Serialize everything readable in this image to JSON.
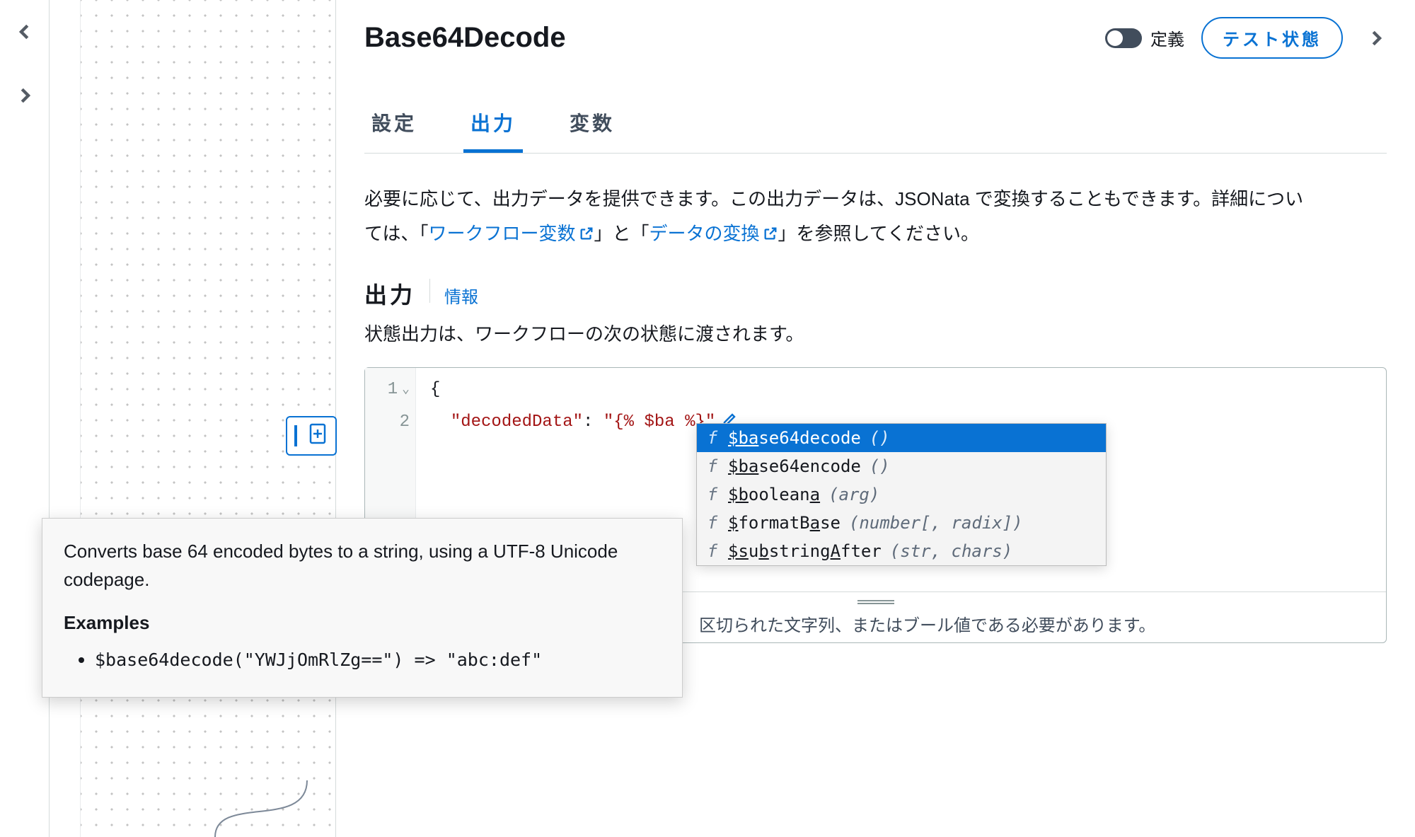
{
  "header": {
    "title": "Base64Decode",
    "toggle_label": "定義",
    "test_button": "テスト状態"
  },
  "tabs": {
    "t0": "設定",
    "t1": "出力",
    "t2": "変数",
    "active": 1
  },
  "description": {
    "pre": "必要に応じて、出力データを提供できます。この出力データは、JSONata で変換することもできます。詳細については、「",
    "link1": "ワークフロー変数",
    "mid": "」と「",
    "link2": "データの変換",
    "post": "」を参照してください。"
  },
  "output": {
    "heading": "出力",
    "info": "情報",
    "sub": "状態出力は、ワークフローの次の状態に渡されます。"
  },
  "editor": {
    "line1_num": "1",
    "line2_num": "2",
    "line1": "{",
    "line2_key": "\"decodedData\"",
    "line2_colon": ": ",
    "line2_val": "\"{% $ba %}\"",
    "footer_note": "区切られた文字列、またはブール値である必要があります。"
  },
  "autocomplete": {
    "items": [
      {
        "kind": "f",
        "pre": "$ba",
        "rest": "se64decode",
        "sig": "()"
      },
      {
        "kind": "f",
        "pre": "$ba",
        "rest": "se64encode",
        "sig": "()"
      },
      {
        "kind": "f",
        "pre": "$b",
        "rest": "oolean",
        "preTail": "a",
        "sig": "(arg)"
      },
      {
        "kind": "f",
        "pre": "$",
        "rest": "formatBase",
        "sig": "(number[, radix])",
        "restUnderIdx": [
          7
        ]
      },
      {
        "kind": "f",
        "pre": "$s",
        "rest": "ubstringAfter",
        "preTail": "",
        "sig": "(str, chars)",
        "restUnderIdx": [
          1,
          8
        ]
      }
    ]
  },
  "tooltip": {
    "desc": "Converts base 64 encoded bytes to a string, using a UTF-8 Unicode codepage.",
    "examples_heading": "Examples",
    "example1": "$base64decode(\"YWJjOmRlZg==\") => \"abc:def\""
  }
}
